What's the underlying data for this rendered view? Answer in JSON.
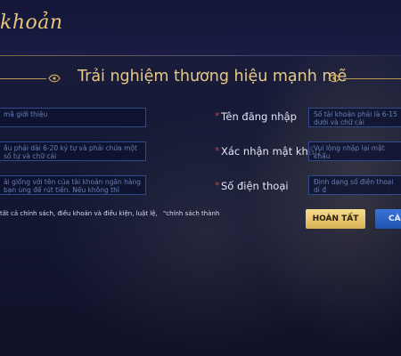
{
  "header": {
    "title": "khoản"
  },
  "slogan": "Trải nghiệm thương hiệu mạnh mẽ",
  "left_fields": [
    {
      "placeholder": "mã giới thiệu"
    },
    {
      "placeholder": "ầu phải dài 6-20 ký tự và phải chứa một số tự và chữ cái"
    },
    {
      "placeholder": "ải giống với tên của tài khoản ngân hàng bạn ùng để rút tiền. Nếu không thì không thể rút"
    }
  ],
  "right_fields": [
    {
      "label": "Tên đăng nhập",
      "placeholder": "Số tài khoản phải là 6-15 dưới và chữ cái"
    },
    {
      "label": "Xác nhận mật khẩu",
      "placeholder": "Vui lòng nhập lại mật khẩu"
    },
    {
      "label": "Số điện thoại",
      "placeholder": "Định dạng số điện thoại di đ"
    }
  ],
  "terms": {
    "text": "tất cả chính sách, điều khoản và điều kiện, luật lệ,",
    "link": "\"chính sách thành"
  },
  "buttons": {
    "done": "HOÀN TẤT",
    "cancel": "CÀ"
  },
  "colors": {
    "accent_gold": "#e6c888",
    "required_star": "#d63a3a",
    "button_done": "#f0d27a",
    "button_cancel": "#2a62c8"
  }
}
